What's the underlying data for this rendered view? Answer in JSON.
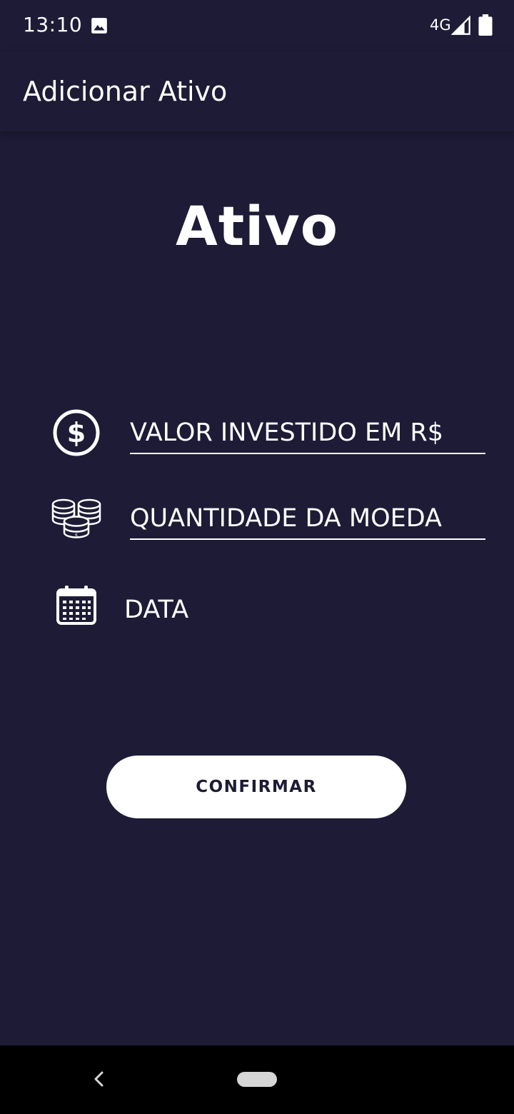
{
  "status_bar": {
    "time": "13:10",
    "network": "4G",
    "icons": [
      "image-icon",
      "signal-icon",
      "battery-icon"
    ]
  },
  "app_bar": {
    "title": "Adicionar Ativo"
  },
  "heading": "Ativo",
  "form": {
    "invested_value": {
      "icon": "dollar-circle-icon",
      "placeholder": "VALOR INVESTIDO EM R$",
      "value": ""
    },
    "coin_quantity": {
      "icon": "coins-stack-icon",
      "placeholder": "QUANTIDADE DA MOEDA",
      "value": ""
    },
    "date": {
      "icon": "calendar-icon",
      "label": "DATA"
    }
  },
  "confirm_button": {
    "label": "CONFIRMAR"
  },
  "nav_bar": {
    "icons": [
      "back-icon",
      "home-pill"
    ]
  },
  "colors": {
    "background": "#1d1b35",
    "foreground": "#ffffff",
    "button_text": "#1d1b35",
    "nav_bar": "#000000"
  }
}
